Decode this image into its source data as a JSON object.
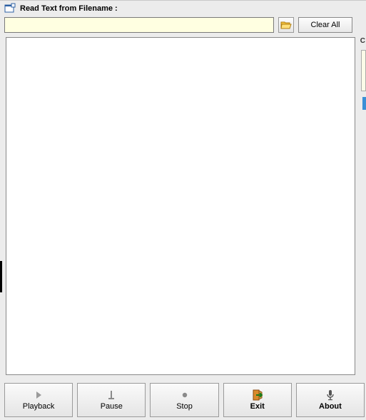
{
  "header": {
    "label": "Read Text from Filename :"
  },
  "file": {
    "value": "",
    "placeholder": ""
  },
  "buttons": {
    "clear": "Clear All"
  },
  "textarea": {
    "value": ""
  },
  "sidefrag": {
    "letter": "C"
  },
  "toolbar": {
    "playback": "Playback",
    "pause": "Pause",
    "stop": "Stop",
    "exit": "Exit",
    "about": "About"
  },
  "icons": {
    "app": "app-icon",
    "browse": "folder-open-icon",
    "playback": "play-icon",
    "pause": "pause-marker-icon",
    "stop": "stop-dot-icon",
    "exit": "exit-door-icon",
    "about": "microphone-icon"
  }
}
